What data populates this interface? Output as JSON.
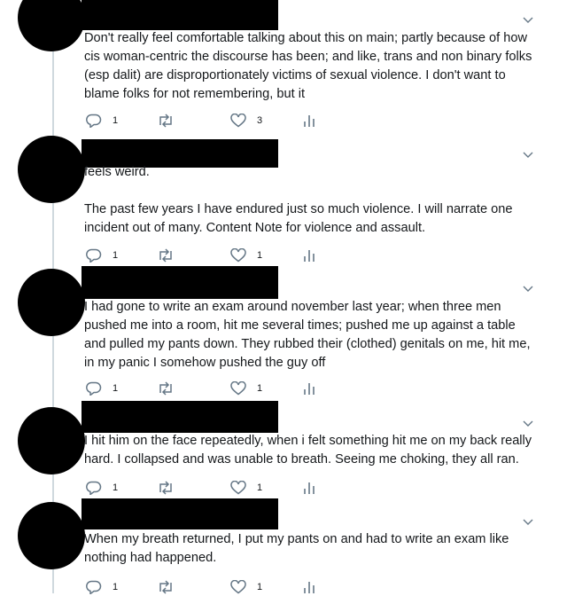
{
  "tweets": [
    {
      "paragraphs": [
        "Don't really feel comfortable talking about this on main; partly because of how cis woman-centric the discourse has been; and like, trans and non binary folks (esp dalit) are disproportionately victims of sexual violence. I don't want to blame folks for not remembering, but it"
      ],
      "reply_count": "1",
      "retweet_count": "",
      "like_count": "3"
    },
    {
      "paragraphs": [
        "feels weird.",
        "The past few years I have endured just so much violence. I will narrate one incident out of many. Content Note for violence and assault."
      ],
      "reply_count": "1",
      "retweet_count": "",
      "like_count": "1"
    },
    {
      "paragraphs": [
        "I had gone to write an exam around november last year; when three men pushed me into a room, hit me several times; pushed me up against a table and pulled my pants down. They rubbed their (clothed) genitals on me, hit me, in my panic I somehow pushed the guy off"
      ],
      "reply_count": "1",
      "retweet_count": "",
      "like_count": "1"
    },
    {
      "paragraphs": [
        "I hit him on the face repeatedly, when i felt something hit me on my back really hard. I collapsed and was unable to breath. Seeing me choking, they all ran."
      ],
      "reply_count": "1",
      "retweet_count": "",
      "like_count": "1"
    },
    {
      "paragraphs": [
        "When my breath returned, I put my pants on and had to write an exam like nothing had happened."
      ],
      "reply_count": "1",
      "retweet_count": "",
      "like_count": "1"
    }
  ],
  "icons": {
    "reply": "reply-icon",
    "retweet": "retweet-icon",
    "like": "heart-icon",
    "analytics": "analytics-icon",
    "menu": "chevron-down-icon"
  },
  "colors": {
    "icon": "#657786",
    "text": "#14171a",
    "thread_line": "#cfd9de",
    "redaction": "#000000"
  }
}
